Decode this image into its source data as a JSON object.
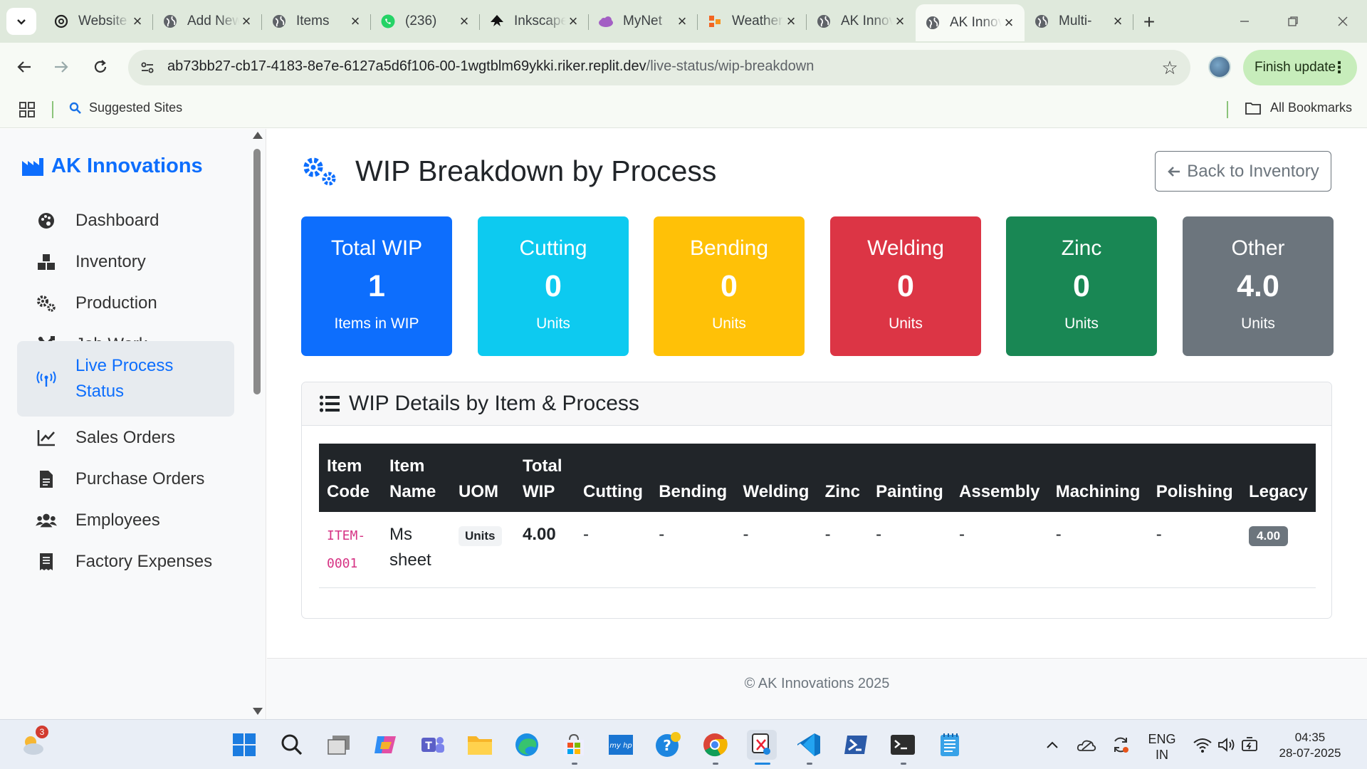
{
  "browser": {
    "tabs": [
      {
        "title": "Website",
        "favicon": "openai-icon"
      },
      {
        "title": "Add New",
        "favicon": "globe-icon"
      },
      {
        "title": "Items",
        "favicon": "globe-icon"
      },
      {
        "title": "(236)",
        "favicon": "whatsapp-icon"
      },
      {
        "title": "Inkscape",
        "favicon": "inkscape-icon"
      },
      {
        "title": "MyNet",
        "favicon": "cloud-icon"
      },
      {
        "title": "Weather",
        "favicon": "weather-icon"
      },
      {
        "title": "AK Innovations",
        "favicon": "globe-icon"
      },
      {
        "title": "AK Innovations",
        "favicon": "globe-icon",
        "active": true
      },
      {
        "title": "Multi-",
        "favicon": "globe-icon"
      }
    ],
    "url_host": "ab73bb27-cb17-4183-8e7e-6127a5d6f106-00-1wgtblm69ykki.riker.replit.dev",
    "url_path": "/live-status/wip-breakdown",
    "finish_update": "Finish update",
    "bookmarks": {
      "suggested": "Suggested Sites",
      "all": "All Bookmarks"
    }
  },
  "sidebar": {
    "brand": "AK Innovations",
    "items": [
      {
        "label": "Dashboard",
        "icon": "palette-icon"
      },
      {
        "label": "Inventory",
        "icon": "boxes-icon"
      },
      {
        "label": "Production",
        "icon": "cogs-icon"
      },
      {
        "label": "Job Work",
        "icon": "tools-icon"
      },
      {
        "label": "Live Process Status",
        "label_line1": "Live Process",
        "label_line2": "Status",
        "icon": "broadcast-icon",
        "active": true
      },
      {
        "label": "Sales Orders",
        "icon": "chart-line-icon"
      },
      {
        "label": "Purchase Orders",
        "icon": "file-icon"
      },
      {
        "label": "Employees",
        "icon": "users-icon"
      },
      {
        "label": "Factory Expenses",
        "icon": "receipt-icon"
      }
    ]
  },
  "main": {
    "title": "WIP Breakdown by Process",
    "back_button": "Back to Inventory",
    "cards": [
      {
        "title": "Total WIP",
        "value": "1",
        "unit": "Items in WIP",
        "color": "#0d6efd"
      },
      {
        "title": "Cutting",
        "value": "0",
        "unit": "Units",
        "color": "#0dcaf0"
      },
      {
        "title": "Bending",
        "value": "0",
        "unit": "Units",
        "color": "#ffc107"
      },
      {
        "title": "Welding",
        "value": "0",
        "unit": "Units",
        "color": "#dc3545"
      },
      {
        "title": "Zinc",
        "value": "0",
        "unit": "Units",
        "color": "#198754"
      },
      {
        "title": "Other",
        "value": "4.0",
        "unit": "Units",
        "color": "#6c757d"
      }
    ],
    "details": {
      "title": "WIP Details by Item & Process",
      "columns": [
        "Item Code",
        "Item Name",
        "UOM",
        "Total WIP",
        "Cutting",
        "Bending",
        "Welding",
        "Zinc",
        "Painting",
        "Assembly",
        "Machining",
        "Polishing",
        "Legacy"
      ],
      "rows": [
        {
          "code_line1": "ITEM-",
          "code_line2": "0001",
          "name_line1": "Ms",
          "name_line2": "sheet",
          "uom": "Units",
          "total": "4.00",
          "cutting": "-",
          "bending": "-",
          "welding": "-",
          "zinc": "-",
          "painting": "-",
          "assembly": "-",
          "machining": "-",
          "polishing": "-",
          "legacy": "4.00"
        }
      ]
    },
    "footer": "© AK Innovations 2025"
  },
  "taskbar": {
    "weather_badge": "3",
    "lang_line1": "ENG",
    "lang_line2": "IN",
    "time": "04:35",
    "date": "28-07-2025"
  }
}
